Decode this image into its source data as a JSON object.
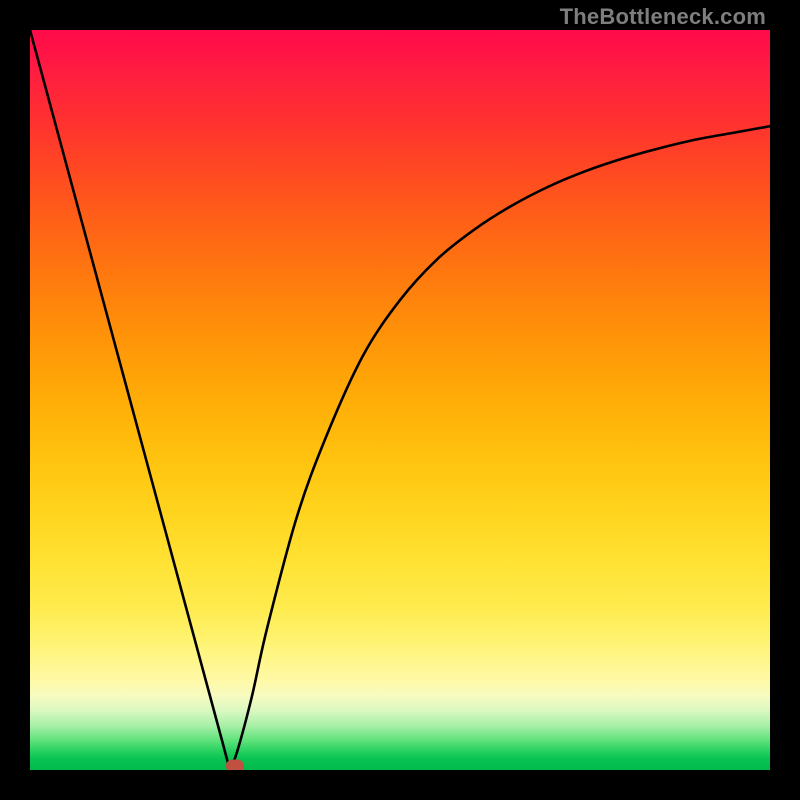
{
  "attribution": "TheBottleneck.com",
  "chart_data": {
    "type": "line",
    "title": "",
    "xlabel": "",
    "ylabel": "",
    "ylim": [
      0,
      100
    ],
    "x": [
      0,
      2,
      4,
      6,
      8,
      10,
      12,
      14,
      16,
      18,
      20,
      22,
      24,
      26,
      27,
      28,
      30,
      32,
      36,
      40,
      45,
      50,
      55,
      60,
      65,
      70,
      75,
      80,
      85,
      90,
      95,
      100
    ],
    "values": [
      100,
      92.6,
      85.2,
      77.8,
      70.4,
      63.0,
      55.6,
      48.2,
      40.8,
      33.4,
      26.0,
      18.6,
      11.2,
      3.8,
      0.0,
      2.5,
      10.0,
      19.0,
      34.0,
      45.0,
      56.0,
      63.5,
      69.0,
      73.0,
      76.2,
      78.8,
      80.9,
      82.6,
      84.0,
      85.2,
      86.1,
      87.0
    ],
    "marker": {
      "x": 27.7,
      "y": 0.6
    },
    "background_gradient": {
      "top": "#ff0a4a",
      "bottom": "#02b94c"
    }
  }
}
